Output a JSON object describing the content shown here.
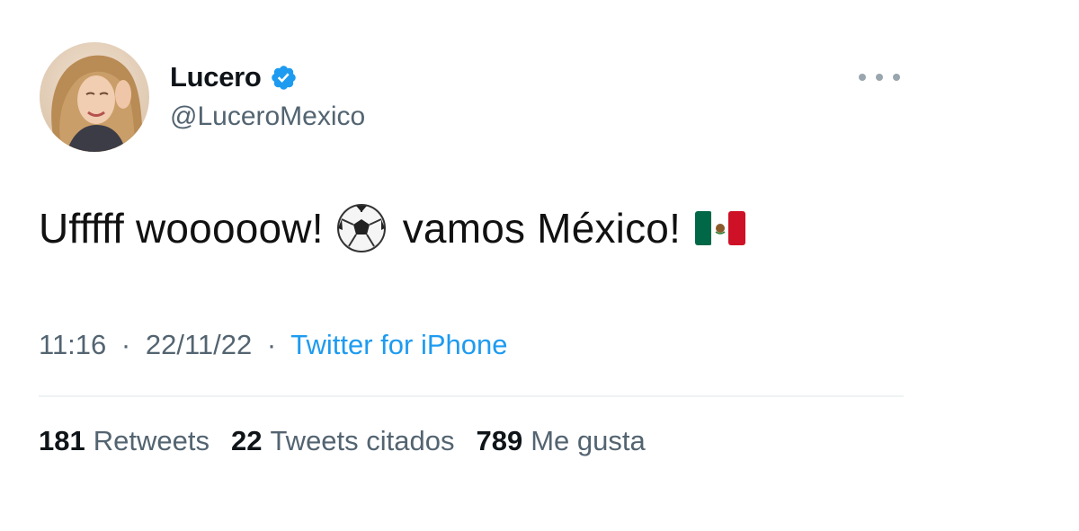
{
  "user": {
    "display_name": "Lucero",
    "handle": "@LuceroMexico",
    "verified_icon": "verified-badge-icon",
    "avatar_icon": "profile-photo"
  },
  "tweet": {
    "text_part1": "Ufffff wooooow!",
    "emoji1": "soccer-ball-icon",
    "text_part2": "vamos México!",
    "emoji2": "mexico-flag-icon"
  },
  "meta": {
    "time": "11:16",
    "separator": "·",
    "date": "22/11/22",
    "source": "Twitter for iPhone"
  },
  "stats": [
    {
      "count": "181",
      "label": "Retweets"
    },
    {
      "count": "22",
      "label": "Tweets citados"
    },
    {
      "count": "789",
      "label": "Me gusta"
    }
  ],
  "colors": {
    "link_blue": "#1d9bf0",
    "secondary_text": "#536471",
    "primary_text": "#0f1419",
    "divider": "#eff3f4"
  }
}
